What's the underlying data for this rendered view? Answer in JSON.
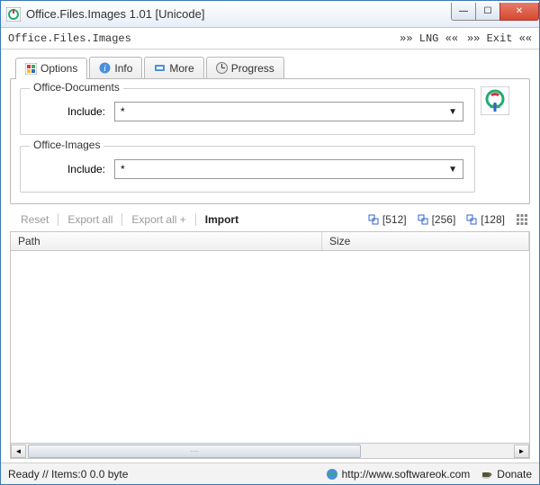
{
  "window": {
    "title": "Office.Files.Images 1.01 [Unicode]"
  },
  "appbar": {
    "breadcrumb": "Office.Files.Images",
    "lng": "»» LNG ««",
    "exit": "»» Exit ««"
  },
  "tabs": {
    "options": "Options",
    "info": "Info",
    "more": "More",
    "progress": "Progress"
  },
  "panel": {
    "docs": {
      "legend": "Office-Documents",
      "label": "Include:",
      "value": "*"
    },
    "imgs": {
      "legend": "Office-Images",
      "label": "Include:",
      "value": "*"
    }
  },
  "toolbar": {
    "reset": "Reset",
    "export_all": "Export all",
    "export_all_plus": "Export all +",
    "import": "Import",
    "s512": "[512]",
    "s256": "[256]",
    "s128": "[128]"
  },
  "columns": {
    "path": "Path",
    "size": "Size"
  },
  "status": {
    "text": "Ready // Items:0 0.0 byte",
    "link": "http://www.softwareok.com",
    "donate": "Donate"
  }
}
